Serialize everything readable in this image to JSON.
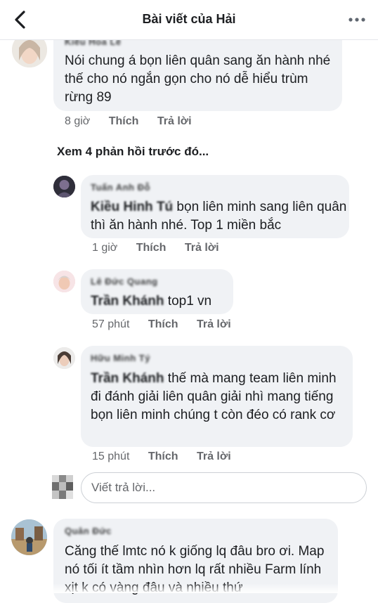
{
  "header": {
    "title": "Bài viết của Hải"
  },
  "comments": [
    {
      "author": "Kiều Hoa Lê",
      "text": "Nói chung á bọn liên quân sang ăn hành nhé thế cho nó ngắn gọn cho nó dễ hiểu trùm rừng 89",
      "time": "8 giờ",
      "like": "Thích",
      "reply": "Trả lời"
    }
  ],
  "view_previous": "Xem 4 phản hồi trước đó...",
  "replies": [
    {
      "author": "Tuấn Anh Đỗ",
      "mention": "Kiều Hinh Tú",
      "text": " bọn liên minh sang liên quân thì ăn hành nhé. Top 1 miền bắc",
      "time": "1 giờ",
      "like": "Thích",
      "reply": "Trả lời"
    },
    {
      "author": "Lê Đức Quang",
      "mention": "Trần Khánh",
      "text": " top1 vn",
      "time": "57 phút",
      "like": "Thích",
      "reply": "Trả lời"
    },
    {
      "author": "Hữu Minh Tý",
      "mention": "Trần Khánh",
      "text": " thế mà mang team liên minh đi đánh giải liên quân giải nhì mang tiếng bọn liên minh chúng t còn đéo có rank cơ",
      "time": "15 phút",
      "like": "Thích",
      "reply": "Trả lời"
    }
  ],
  "reply_box": {
    "placeholder": "Viết trả lời..."
  },
  "next_comment": {
    "author": "Quân Đức",
    "text": "Căng thế lmtc nó k giống lq đâu bro ơi. Map nó tối ít tầm nhìn hơn lq rất nhiều Farm lính xịt k có vàng đâu và nhiều thứ"
  }
}
